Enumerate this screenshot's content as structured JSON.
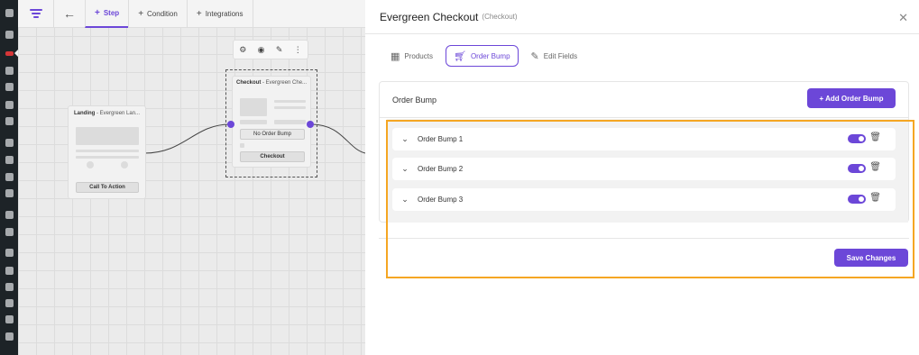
{
  "canvas": {
    "back_icon": "arrow-left-icon",
    "tabs": [
      {
        "label": "Step",
        "icon": "plus-icon",
        "active": true
      },
      {
        "label": "Condition",
        "icon": "plus-icon",
        "active": false
      },
      {
        "label": "Integrations",
        "icon": "plus-icon",
        "active": false
      }
    ],
    "nodes": {
      "landing": {
        "title": "Landing",
        "subtitle": "- Evergreen Lan...",
        "cta": "Call To Action"
      },
      "checkout": {
        "title": "Checkout",
        "subtitle": "- Evergreen Che...",
        "bump_label": "No Order Bump",
        "cta": "Checkout"
      }
    },
    "node_toolbar_icons": [
      "gear-icon",
      "eye-icon",
      "pencil-icon",
      "more-vertical-icon"
    ]
  },
  "panel": {
    "title": "Evergreen Checkout",
    "subtitle": "(Checkout)",
    "close_icon": "close-icon",
    "tabs": [
      {
        "label": "Products",
        "icon": "grid-icon",
        "active": false
      },
      {
        "label": "Order Bump",
        "icon": "cart-icon",
        "active": true
      },
      {
        "label": "Edit Fields",
        "icon": "pencil-icon",
        "active": false
      }
    ],
    "order_bump": {
      "heading": "Order Bump",
      "add_button": "+ Add Order Bump",
      "items": [
        {
          "label": "Order Bump 1",
          "enabled": true
        },
        {
          "label": "Order Bump 2",
          "enabled": true
        },
        {
          "label": "Order Bump 3",
          "enabled": true
        }
      ]
    },
    "save_button": "Save Changes"
  },
  "colors": {
    "accent": "#6c47d8",
    "highlight": "#f5a623",
    "wp_sidebar": "#1d2327"
  }
}
